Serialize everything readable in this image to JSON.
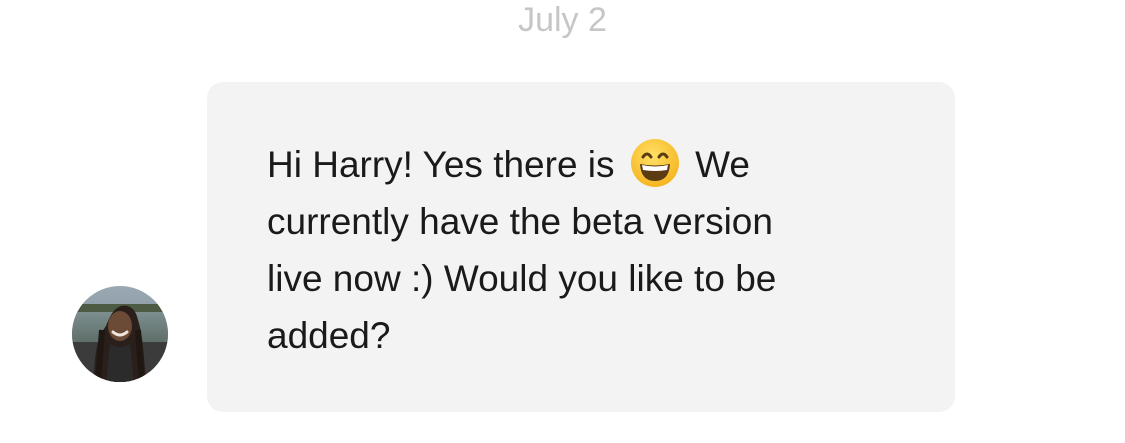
{
  "conversation": {
    "date_separator": "July 2",
    "message": {
      "sender_avatar": "avatar-woman-outdoors",
      "line_1_before_emoji": "Hi Harry! Yes there is",
      "emoji": "grinning-face-with-smiling-eyes-emoji",
      "line_1_after_emoji": "We",
      "line_2": "currently have the beta version",
      "line_3": "live now :) Would you like to be",
      "line_4": "added?"
    }
  },
  "colors": {
    "background": "#ffffff",
    "bubble": "#f3f3f3",
    "date_text": "#c6c6c6",
    "message_text": "#1a1a1a"
  }
}
